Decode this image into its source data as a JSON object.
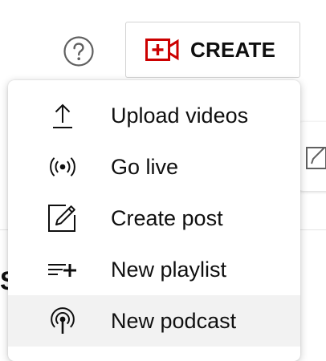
{
  "header": {
    "help_icon": "help-circle-icon",
    "create_button": {
      "icon": "add-video-icon",
      "label": "CREATE",
      "icon_color": "#cc0000"
    }
  },
  "menu": {
    "items": [
      {
        "icon": "upload-icon",
        "label": "Upload videos"
      },
      {
        "icon": "live-broadcast-icon",
        "label": "Go live"
      },
      {
        "icon": "edit-post-icon",
        "label": "Create post"
      },
      {
        "icon": "add-to-playlist-icon",
        "label": "New playlist"
      },
      {
        "icon": "podcast-icon",
        "label": "New podcast",
        "hovered": true
      }
    ]
  },
  "background": {
    "partial_heading": "S"
  }
}
